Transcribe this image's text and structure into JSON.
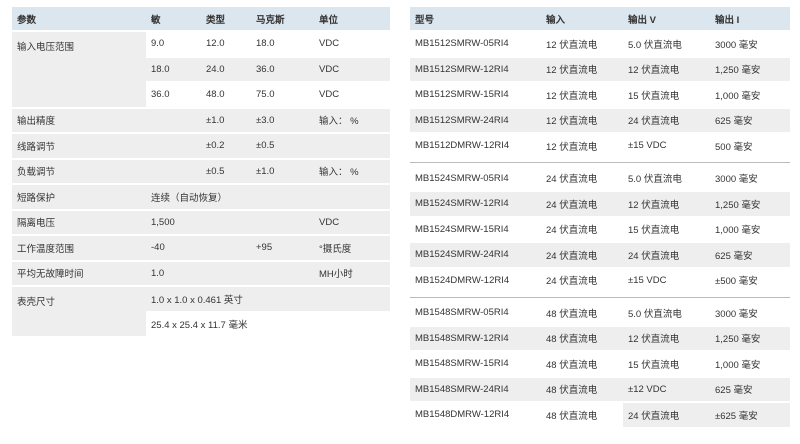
{
  "specs": {
    "headers": [
      "参数",
      "敏",
      "类型",
      "马克斯",
      "单位"
    ],
    "rows": [
      {
        "param": "输入电压范围",
        "min": "9.0",
        "typ": "12.0",
        "max": "18.0",
        "unit": "VDC"
      },
      {
        "param": "",
        "min": "18.0",
        "typ": "24.0",
        "max": "36.0",
        "unit": "VDC"
      },
      {
        "param": "",
        "min": "36.0",
        "typ": "48.0",
        "max": "75.0",
        "unit": "VDC"
      },
      {
        "param": "输出精度",
        "min": "",
        "typ": "±1.0",
        "max": "±3.0",
        "unit": "输入：  %"
      },
      {
        "param": "线路调节",
        "min": "",
        "typ": "±0.2",
        "max": "±0.5",
        "unit": ""
      },
      {
        "param": "负载调节",
        "min": "",
        "typ": "±0.5",
        "max": "±1.0",
        "unit": "输入：  %"
      },
      {
        "param": "短路保护",
        "value": "连续（自动恢复）"
      },
      {
        "param": "隔离电压",
        "min": "1,500",
        "typ": "",
        "max": "",
        "unit": "VDC"
      },
      {
        "param": "工作温度范围",
        "min": "-40",
        "typ": "",
        "max": "+95",
        "unit": "°摄氏度"
      },
      {
        "param": "平均无故障时间",
        "min": "1.0",
        "typ": "",
        "max": "",
        "unit": "MH小时"
      },
      {
        "param": "表壳尺寸",
        "value": "1.0 x 1.0 x 0.461 英寸"
      },
      {
        "param": "",
        "value": "25.4 x 25.4 x 11.7 毫米"
      }
    ]
  },
  "models": {
    "headers": [
      "型号",
      "输入",
      "输出 V",
      "输出 I"
    ],
    "groups": [
      {
        "rows": [
          {
            "model": "MB1512SMRW-05RI4",
            "input": "12 伏直流电",
            "vout": "5.0 伏直流电",
            "iout": "3000 毫安"
          },
          {
            "model": "MB1512SMRW-12RI4",
            "input": "12 伏直流电",
            "vout": "12 伏直流电",
            "iout": "1,250 毫安"
          },
          {
            "model": "MB1512SMRW-15RI4",
            "input": "12 伏直流电",
            "vout": "15 伏直流电",
            "iout": "1,000 毫安"
          },
          {
            "model": "MB1512SMRW-24RI4",
            "input": "12 伏直流电",
            "vout": "24 伏直流电",
            "iout": "625 毫安"
          },
          {
            "model": "MB1512DMRW-12RI4",
            "input": "12 伏直流电",
            "vout": "±15 VDC",
            "iout": "500 毫安"
          }
        ]
      },
      {
        "rows": [
          {
            "model": "MB1524SMRW-05RI4",
            "input": "24 伏直流电",
            "vout": "5.0 伏直流电",
            "iout": "3000 毫安"
          },
          {
            "model": "MB1524SMRW-12RI4",
            "input": "24 伏直流电",
            "vout": "12 伏直流电",
            "iout": "1,250 毫安"
          },
          {
            "model": "MB1524SMRW-15RI4",
            "input": "24 伏直流电",
            "vout": "15 伏直流电",
            "iout": "1,000 毫安"
          },
          {
            "model": "MB1524SMRW-24RI4",
            "input": "24 伏直流电",
            "vout": "24 伏直流电",
            "iout": "625 毫安"
          },
          {
            "model": "MB1524DMRW-12RI4",
            "input": "24 伏直流电",
            "vout": "±15 VDC",
            "iout": "±500 毫安"
          }
        ]
      },
      {
        "rows": [
          {
            "model": "MB1548SMRW-05RI4",
            "input": "48 伏直流电",
            "vout": "5.0 伏直流电",
            "iout": "3000 毫安"
          },
          {
            "model": "MB1548SMRW-12RI4",
            "input": "48 伏直流电",
            "vout": "12 伏直流电",
            "iout": "1,250 毫安"
          },
          {
            "model": "MB1548SMRW-15RI4",
            "input": "48 伏直流电",
            "vout": "15 伏直流电",
            "iout": "1,000 毫安"
          },
          {
            "model": "MB1548SMRW-24RI4",
            "input": "48 伏直流电",
            "vout": "±12 VDC",
            "iout": "625 毫安"
          },
          {
            "model": "MB1548DMRW-12RI4",
            "input": "48 伏直流电",
            "vout": "24 伏直流电",
            "iout": "±625 毫安"
          }
        ]
      }
    ]
  }
}
